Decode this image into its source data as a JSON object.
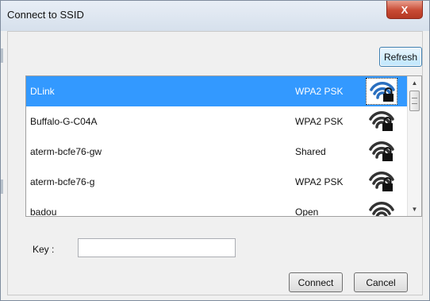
{
  "window": {
    "title": "Connect to SSID",
    "close_glyph": "X"
  },
  "toolbar": {
    "refresh_label": "Refresh"
  },
  "networks": [
    {
      "ssid": "DLink",
      "security": "WPA2 PSK",
      "signal": "wifi-locked-icon",
      "selected": true
    },
    {
      "ssid": "Buffalo-G-C04A",
      "security": "WPA2 PSK",
      "signal": "wifi-locked-icon",
      "selected": false
    },
    {
      "ssid": "aterm-bcfe76-gw",
      "security": "Shared",
      "signal": "wifi-locked-icon",
      "selected": false
    },
    {
      "ssid": "aterm-bcfe76-g",
      "security": "WPA2 PSK",
      "signal": "wifi-locked-icon",
      "selected": false
    },
    {
      "ssid": "badou",
      "security": "Open",
      "signal": "wifi-icon",
      "selected": false
    }
  ],
  "key": {
    "label": "Key :",
    "value": "",
    "placeholder": ""
  },
  "actions": {
    "connect_label": "Connect",
    "cancel_label": "Cancel"
  },
  "colors": {
    "selection": "#3399ff",
    "signal_selected": "#2a6fbf",
    "signal_default": "#333333"
  }
}
